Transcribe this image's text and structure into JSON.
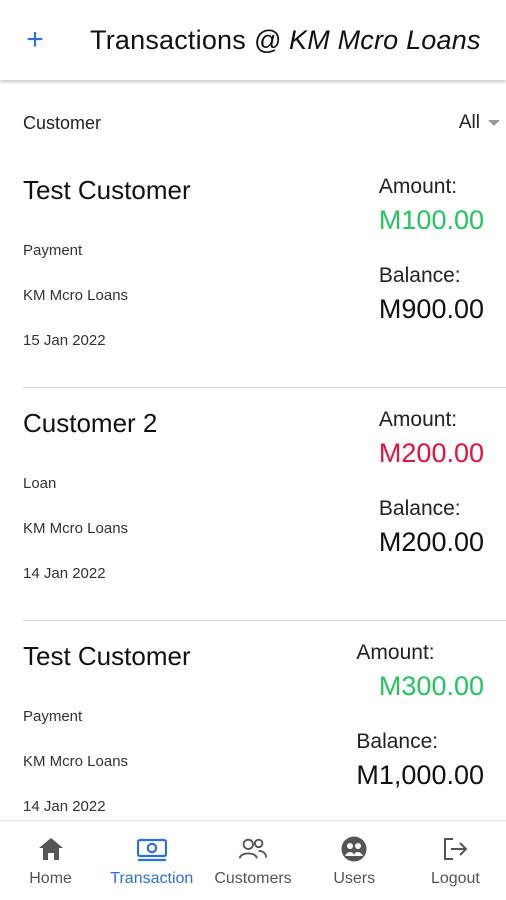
{
  "appbar": {
    "add_label": "+",
    "title_prefix": "Transactions ",
    "title_suffix": "@ KM Mcro Loans"
  },
  "filter": {
    "label": "Customer",
    "value": "All"
  },
  "transactions": [
    {
      "customer": "Test Customer",
      "type": "Payment",
      "organization": "KM Mcro Loans",
      "date": "15 Jan 2022",
      "amount_label": "Amount:",
      "amount": "M100.00",
      "amount_color": "#25c45f",
      "balance_label": "Balance:",
      "balance": "M900.00"
    },
    {
      "customer": "Customer 2",
      "type": "Loan",
      "organization": "KM Mcro Loans",
      "date": "14 Jan 2022",
      "amount_label": "Amount:",
      "amount": "M200.00",
      "amount_color": "#e0143c",
      "balance_label": "Balance:",
      "balance": "M200.00"
    },
    {
      "customer": "Test Customer",
      "type": "Payment",
      "organization": "KM Mcro Loans",
      "date": "14 Jan 2022",
      "amount_label": "Amount:",
      "amount": "M300.00",
      "amount_color": "#25c45f",
      "balance_label": "Balance:",
      "balance": "M1,000.00"
    }
  ],
  "nav": {
    "active_color": "#2f6fdd",
    "items": [
      {
        "label": "Home",
        "icon": "home-icon"
      },
      {
        "label": "Transaction",
        "icon": "transaction-icon"
      },
      {
        "label": "Customers",
        "icon": "customers-icon"
      },
      {
        "label": "Users",
        "icon": "users-icon"
      },
      {
        "label": "Logout",
        "icon": "logout-icon"
      }
    ]
  }
}
